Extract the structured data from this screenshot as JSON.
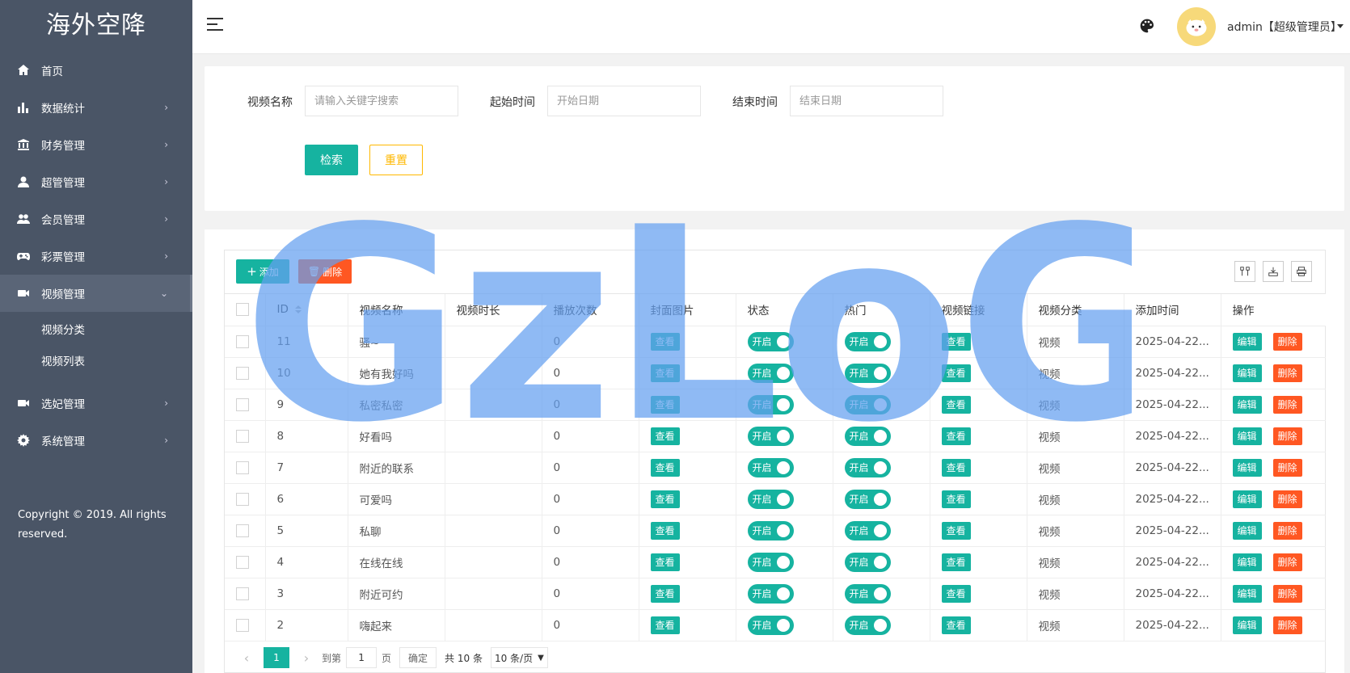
{
  "app": {
    "title": "海外空降"
  },
  "sidebar": {
    "items": [
      {
        "label": "首页",
        "icon": "home-icon",
        "has_children": false
      },
      {
        "label": "数据统计",
        "icon": "bar-chart-icon",
        "has_children": true
      },
      {
        "label": "财务管理",
        "icon": "bank-icon",
        "has_children": true
      },
      {
        "label": "超管管理",
        "icon": "user-icon",
        "has_children": true
      },
      {
        "label": "会员管理",
        "icon": "users-icon",
        "has_children": true
      },
      {
        "label": "彩票管理",
        "icon": "gamepad-icon",
        "has_children": true
      },
      {
        "label": "视频管理",
        "icon": "video-icon",
        "has_children": true,
        "expanded": true
      }
    ],
    "submenu": [
      {
        "label": "视频分类"
      },
      {
        "label": "视频列表"
      }
    ],
    "items_after": [
      {
        "label": "选妃管理",
        "icon": "video-icon",
        "has_children": true
      },
      {
        "label": "系统管理",
        "icon": "gear-icon",
        "has_children": true
      }
    ],
    "copyright": "Copyright © 2019. All rights reserved."
  },
  "header": {
    "user": "admin【超级管理员】"
  },
  "search": {
    "name_label": "视频名称",
    "name_placeholder": "请输入关键字搜索",
    "start_label": "起始时间",
    "start_placeholder": "开始日期",
    "end_label": "结束时间",
    "end_placeholder": "结束日期",
    "search_button": "检索",
    "reset_button": "重置"
  },
  "toolbar": {
    "add_label": "添加",
    "delete_label": "删除"
  },
  "table": {
    "columns": [
      "ID",
      "视频名称",
      "视频时长",
      "播放次数",
      "封面图片",
      "状态",
      "热门",
      "视频链接",
      "视频分类",
      "添加时间",
      "操作"
    ],
    "view_label": "查看",
    "switch_label": "开启",
    "edit_label": "编辑",
    "delete_label": "删除",
    "rows": [
      {
        "id": "11",
        "name": "骚~",
        "duration": "",
        "plays": "0",
        "category": "视频",
        "added": "2025-04-22..."
      },
      {
        "id": "10",
        "name": "她有我好吗",
        "duration": "",
        "plays": "0",
        "category": "视频",
        "added": "2025-04-22..."
      },
      {
        "id": "9",
        "name": "私密私密",
        "duration": "",
        "plays": "0",
        "category": "视频",
        "added": "2025-04-22..."
      },
      {
        "id": "8",
        "name": "好看吗",
        "duration": "",
        "plays": "0",
        "category": "视频",
        "added": "2025-04-22..."
      },
      {
        "id": "7",
        "name": "附近的联系",
        "duration": "",
        "plays": "0",
        "category": "视频",
        "added": "2025-04-22..."
      },
      {
        "id": "6",
        "name": "可爱吗",
        "duration": "",
        "plays": "0",
        "category": "视频",
        "added": "2025-04-22..."
      },
      {
        "id": "5",
        "name": "私聊",
        "duration": "",
        "plays": "0",
        "category": "视频",
        "added": "2025-04-22..."
      },
      {
        "id": "4",
        "name": "在线在线",
        "duration": "",
        "plays": "0",
        "category": "视频",
        "added": "2025-04-22..."
      },
      {
        "id": "3",
        "name": "附近可约",
        "duration": "",
        "plays": "0",
        "category": "视频",
        "added": "2025-04-22..."
      },
      {
        "id": "2",
        "name": "嗨起来",
        "duration": "",
        "plays": "0",
        "category": "视频",
        "added": "2025-04-22..."
      }
    ]
  },
  "pager": {
    "current": "1",
    "goto_label": "到第",
    "goto_value": "1",
    "page_unit": "页",
    "confirm": "确定",
    "total": "共 10 条",
    "page_size": "10 条/页"
  },
  "watermark": "GzLoG",
  "colors": {
    "accent": "#16b3a0",
    "danger": "#ff5722",
    "warning": "#ffb800",
    "sidebar": "#4a5566"
  }
}
